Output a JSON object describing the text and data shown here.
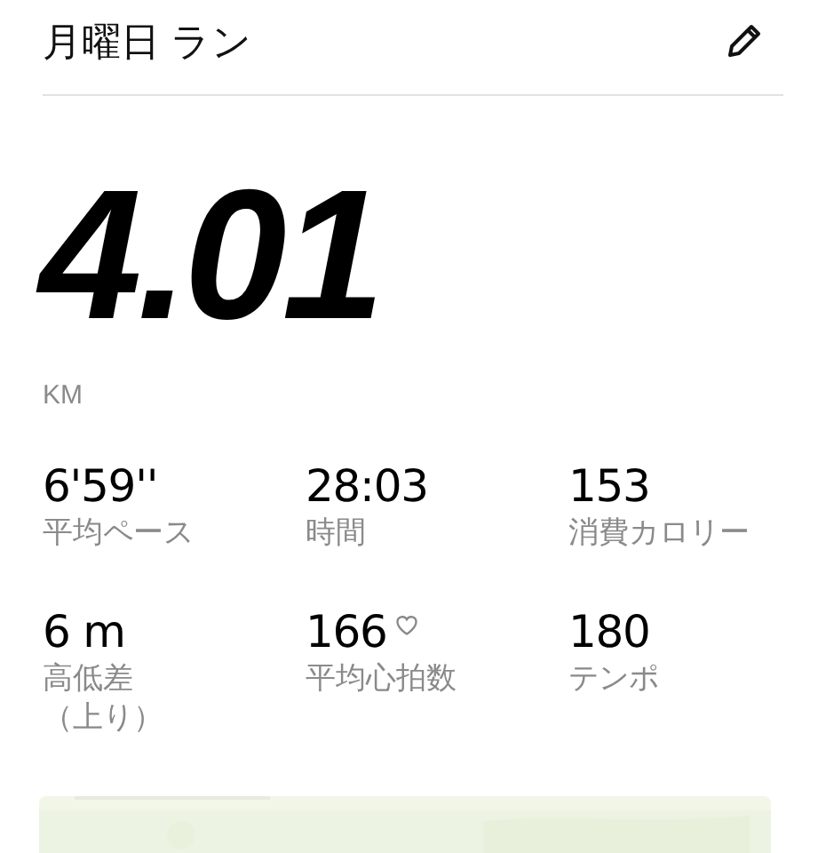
{
  "header": {
    "title": "月曜日 ラン"
  },
  "distance": {
    "value": "4.01",
    "unit": "KM"
  },
  "stats": [
    {
      "value": "6'59''",
      "label": "平均ペース",
      "kind": "plain"
    },
    {
      "value": "28:03",
      "label": "時間",
      "kind": "plain"
    },
    {
      "value": "153",
      "label": "消費カロリー",
      "kind": "plain"
    },
    {
      "value": "6 m",
      "label": "高低差（上り）",
      "kind": "narrow"
    },
    {
      "value": "166",
      "label": "平均心拍数",
      "kind": "heart"
    },
    {
      "value": "180",
      "label": "テンポ",
      "kind": "plain"
    }
  ]
}
